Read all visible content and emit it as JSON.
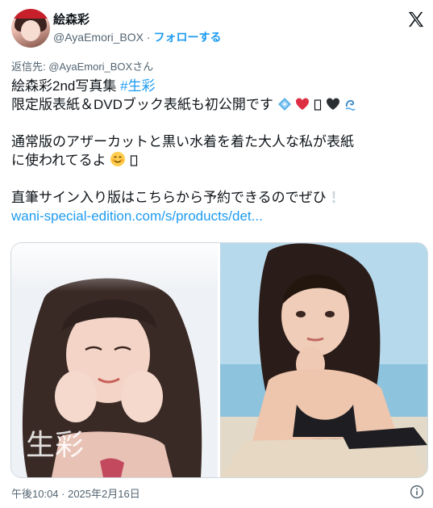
{
  "author": {
    "name": "絵森彩",
    "handle": "@AyaEmori_BOX",
    "separator": " · ",
    "follow_label": "フォローする"
  },
  "reply_to": "返信先: @AyaEmori_BOXさん",
  "tweet": {
    "line1_text": "絵森彩2nd写真集 ",
    "line1_hashtag": "#生彩",
    "line2": "限定版表紙＆DVDブック表紙も初公開です",
    "line3": "通常版のアザーカットと黒い水着を着た大人な私が表紙",
    "line4": "に使われてるよ",
    "line5": "直筆サイン入り版はこちらから予約できるのでぜひ",
    "link": "wani-special-edition.com/s/products/det..."
  },
  "media": {
    "left_overlay_text": "生彩"
  },
  "timestamp": "午後10:04 · 2025年2月16日",
  "icons": {
    "x_logo": "x-logo-icon",
    "info": "info-icon",
    "emoji_diamond": "blue-diamond-emoji",
    "emoji_heart": "red-heart-emoji",
    "emoji_black_heart": "black-heart-emoji",
    "emoji_wave": "wave-emoji",
    "emoji_smile": "smiling-face-emoji",
    "emoji_exclaim": "exclamation-emoji"
  },
  "colors": {
    "accent": "#1d9bf0",
    "text": "#0f1419",
    "muted": "#536471"
  }
}
